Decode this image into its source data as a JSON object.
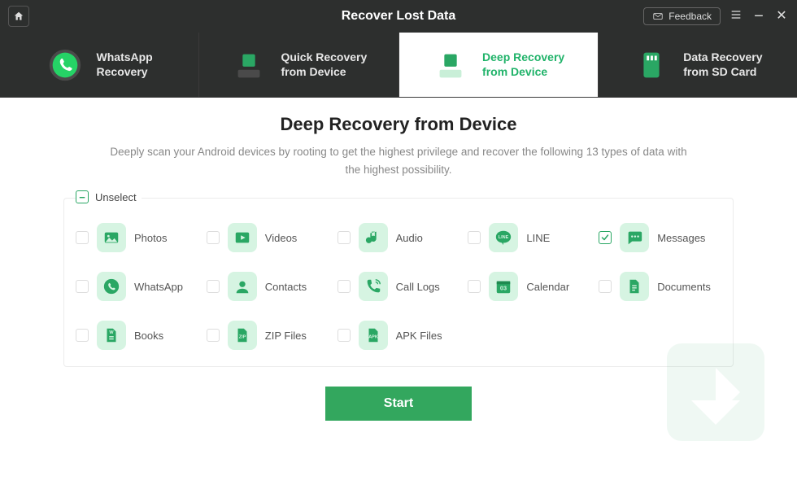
{
  "titlebar": {
    "title": "Recover Lost Data",
    "feedback_label": "Feedback"
  },
  "tabs": [
    {
      "line1": "WhatsApp",
      "line2": "Recovery"
    },
    {
      "line1": "Quick Recovery",
      "line2": "from Device"
    },
    {
      "line1": "Deep Recovery",
      "line2": "from Device"
    },
    {
      "line1": "Data Recovery",
      "line2": "from SD Card"
    }
  ],
  "main": {
    "title": "Deep Recovery from Device",
    "subtitle": "Deeply scan your Android devices by rooting to get the highest privilege and recover the following 13 types of data with the highest possibility.",
    "unselect_label": "Unselect",
    "start_label": "Start"
  },
  "items": [
    {
      "label": "Photos",
      "icon": "photo-icon",
      "checked": false
    },
    {
      "label": "Videos",
      "icon": "video-icon",
      "checked": false
    },
    {
      "label": "Audio",
      "icon": "audio-icon",
      "checked": false
    },
    {
      "label": "LINE",
      "icon": "line-icon",
      "checked": false
    },
    {
      "label": "Messages",
      "icon": "messages-icon",
      "checked": true
    },
    {
      "label": "WhatsApp",
      "icon": "whatsapp-icon",
      "checked": false
    },
    {
      "label": "Contacts",
      "icon": "contacts-icon",
      "checked": false
    },
    {
      "label": "Call Logs",
      "icon": "calllogs-icon",
      "checked": false
    },
    {
      "label": "Calendar",
      "icon": "calendar-icon",
      "checked": false
    },
    {
      "label": "Documents",
      "icon": "documents-icon",
      "checked": false
    },
    {
      "label": "Books",
      "icon": "books-icon",
      "checked": false
    },
    {
      "label": "ZIP Files",
      "icon": "zip-icon",
      "checked": false
    },
    {
      "label": "APK Files",
      "icon": "apk-icon",
      "checked": false
    }
  ]
}
